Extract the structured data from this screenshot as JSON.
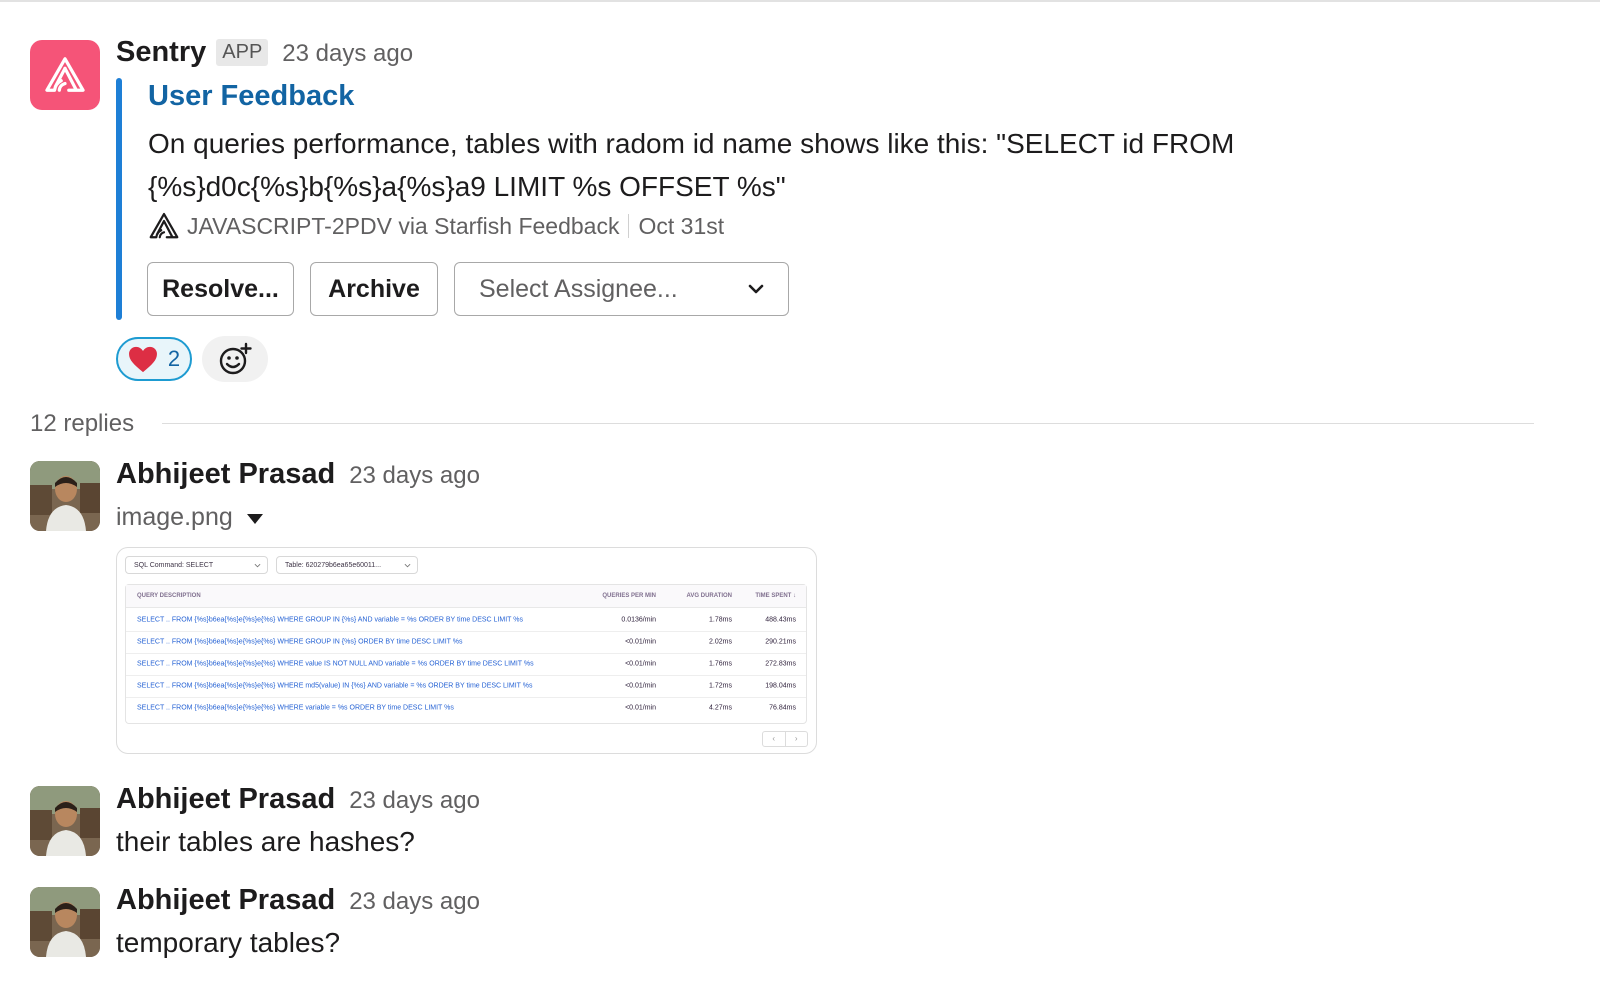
{
  "sentry_message": {
    "author": "Sentry",
    "badge": "APP",
    "time": "23 days ago",
    "attachment": {
      "title": "User Feedback",
      "text_line1": "On queries performance, tables with radom id name shows like this: \"SELECT id FROM",
      "text_line2": "{%s}d0c{%s}b{%s}a{%s}a9 LIMIT %s OFFSET %s\"",
      "footer_source": "JAVASCRIPT-2PDV via Starfish Feedback",
      "footer_date": "Oct 31st"
    },
    "actions": {
      "resolve_label": "Resolve...",
      "archive_label": "Archive",
      "assignee_placeholder": "Select Assignee..."
    },
    "reaction": {
      "emoji": "heart",
      "count": "2"
    }
  },
  "thread": {
    "replies_label": "12 replies"
  },
  "messages": [
    {
      "author": "Abhijeet Prasad",
      "time": "23 days ago",
      "file_name": "image.png",
      "preview": {
        "sql_filter": "SQL Command:  SELECT",
        "table_filter": "Table:  620279b6ea65e60011...",
        "columns": [
          "QUERY DESCRIPTION",
          "QUERIES PER MIN",
          "AVG DURATION",
          "TIME SPENT ↓"
        ],
        "rows": [
          {
            "query": "SELECT .. FROM {%s}b6ea{%s}e{%s}e{%s} WHERE GROUP IN {%s} AND variable = %s ORDER BY time DESC LIMIT %s",
            "qpm": "0.0136/min",
            "avg": "1.78ms",
            "spent": "488.43ms"
          },
          {
            "query": "SELECT .. FROM {%s}b6ea{%s}e{%s}e{%s} WHERE GROUP IN {%s} ORDER BY time DESC LIMIT %s",
            "qpm": "<0.01/min",
            "avg": "2.02ms",
            "spent": "290.21ms"
          },
          {
            "query": "SELECT .. FROM {%s}b6ea{%s}e{%s}e{%s} WHERE value IS NOT NULL AND variable = %s ORDER BY time DESC LIMIT %s",
            "qpm": "<0.01/min",
            "avg": "1.76ms",
            "spent": "272.83ms"
          },
          {
            "query": "SELECT .. FROM {%s}b6ea{%s}e{%s}e{%s} WHERE md5(value) IN {%s} AND variable = %s ORDER BY time DESC LIMIT %s",
            "qpm": "<0.01/min",
            "avg": "1.72ms",
            "spent": "198.04ms"
          },
          {
            "query": "SELECT .. FROM {%s}b6ea{%s}e{%s}e{%s} WHERE variable = %s ORDER BY time DESC LIMIT %s",
            "qpm": "<0.01/min",
            "avg": "4.27ms",
            "spent": "76.84ms"
          }
        ]
      }
    },
    {
      "author": "Abhijeet Prasad",
      "time": "23 days ago",
      "text": "their tables are hashes?"
    },
    {
      "author": "Abhijeet Prasad",
      "time": "23 days ago",
      "text": "temporary tables?"
    }
  ],
  "colors": {
    "sentry_brand": "#f55478",
    "link_blue": "#1264a3",
    "accent_bar": "#1e7fd6",
    "reaction_border": "#1d9bd1"
  }
}
